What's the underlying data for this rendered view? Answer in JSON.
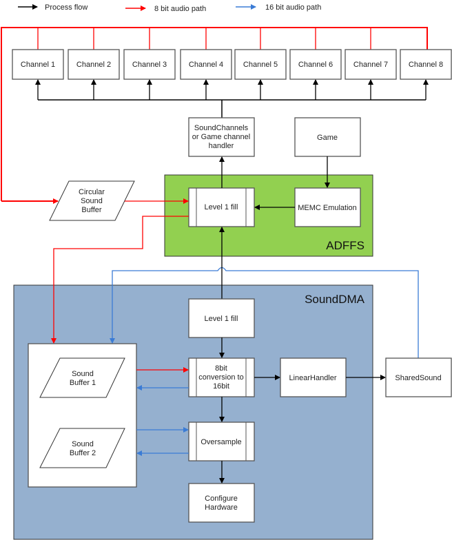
{
  "legend": {
    "items": [
      {
        "label": "Process flow",
        "color": "#000000"
      },
      {
        "label": "8 bit audio path",
        "color": "#ff0000"
      },
      {
        "label": "16 bit audio path",
        "color": "#3a7bd5"
      }
    ]
  },
  "colors": {
    "process": "#000000",
    "audio8": "#ff0000",
    "audio16": "#3a7bd5",
    "adffs_fill": "#92d050",
    "sounddma_fill": "#95b0cf"
  },
  "channels": [
    "Channel 1",
    "Channel 2",
    "Channel 3",
    "Channel 4",
    "Channel 5",
    "Channel 6",
    "Channel 7",
    "Channel 8"
  ],
  "groups": {
    "adffs": "ADFFS",
    "sounddma": "SoundDMA"
  },
  "nodes": {
    "soundchannels": [
      "SoundChannels",
      "or Game channel",
      "handler"
    ],
    "game": "Game",
    "adffs_level1": "Level 1 fill",
    "memc": "MEMC Emulation",
    "circular_buffer": [
      "Circular",
      "Sound",
      "Buffer"
    ],
    "dma_level1": "Level 1 fill",
    "conversion": [
      "8bit",
      "conversion to",
      "16bit"
    ],
    "linear_handler": "LinearHandler",
    "shared_sound": "SharedSound",
    "oversample": "Oversample",
    "configure_hw": [
      "Configure",
      "Hardware"
    ],
    "sound_buffer1": [
      "Sound",
      "Buffer 1"
    ],
    "sound_buffer2": [
      "Sound",
      "Buffer 2"
    ]
  }
}
